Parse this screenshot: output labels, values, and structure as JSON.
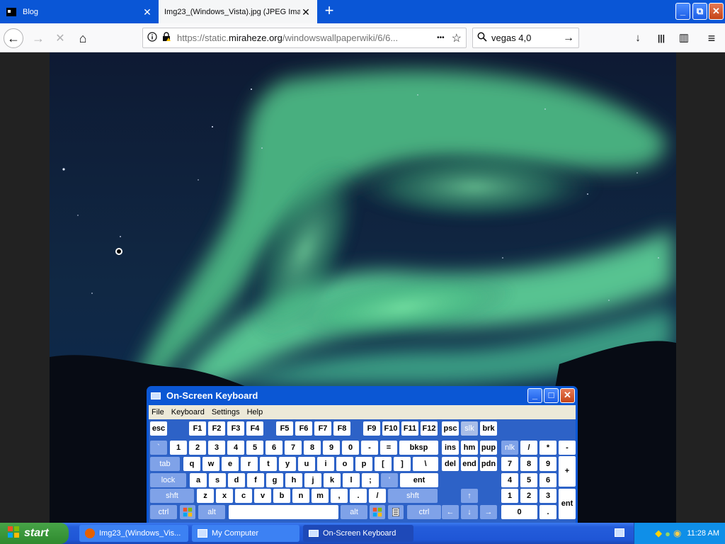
{
  "tabs": [
    {
      "title": "Blog",
      "close": "✕"
    },
    {
      "title": "Img23_(Windows_Vista).jpg (JPEG Ima",
      "close": "✕"
    }
  ],
  "new_tab_label": "+",
  "window_controls": {
    "minimize": "_",
    "restore": "⧉",
    "close": "✕"
  },
  "nav": {
    "back": "←",
    "forward": "→",
    "stop": "✕",
    "home": "⌂",
    "url_prefix": "https://static.",
    "url_host": "miraheze.org",
    "url_path": "/windowswallpaperwiki/6/6...",
    "more": "•••",
    "star": "☆",
    "search_value": "vegas 4,0",
    "search_go": "→",
    "download": "↓",
    "library": "|||",
    "sidebar": "▥",
    "menu": "≡"
  },
  "osk": {
    "title": "On-Screen Keyboard",
    "menu": [
      "File",
      "Keyboard",
      "Settings",
      "Help"
    ],
    "row_fn": [
      "esc",
      "F1",
      "F2",
      "F3",
      "F4",
      "F5",
      "F6",
      "F7",
      "F8",
      "F9",
      "F10",
      "F11",
      "F12",
      "psc",
      "slk",
      "brk"
    ],
    "row1": [
      "`",
      "1",
      "2",
      "3",
      "4",
      "5",
      "6",
      "7",
      "8",
      "9",
      "0",
      "-",
      "=",
      "bksp",
      "ins",
      "hm",
      "pup",
      "nlk",
      "/",
      "*",
      "-"
    ],
    "row2": [
      "tab",
      "q",
      "w",
      "e",
      "r",
      "t",
      "y",
      "u",
      "i",
      "o",
      "p",
      "[",
      "]",
      "\\",
      "del",
      "end",
      "pdn",
      "7",
      "8",
      "9",
      "+"
    ],
    "row3": [
      "lock",
      "a",
      "s",
      "d",
      "f",
      "g",
      "h",
      "j",
      "k",
      "l",
      ";",
      "'",
      "ent",
      "4",
      "5",
      "6"
    ],
    "row4": [
      "shft",
      "z",
      "x",
      "c",
      "v",
      "b",
      "n",
      "m",
      ",",
      ".",
      "/",
      "shft",
      "↑",
      "1",
      "2",
      "3",
      "ent"
    ],
    "row5": [
      "ctrl",
      "alt",
      "alt",
      "ctrl",
      "←",
      "↓",
      "→",
      "0",
      "."
    ],
    "controls": {
      "minimize": "_",
      "maximize": "□",
      "close": "✕"
    }
  },
  "taskbar": {
    "start": "start",
    "items": [
      "Img23_(Windows_Vis...",
      "My Computer",
      "On-Screen Keyboard"
    ],
    "clock": "11:28 AM"
  },
  "colors": {
    "titlebar": "#0a56d6",
    "osk_frame": "#0b57d4",
    "taskbar": "#245ddb",
    "start": "#3c9a3c"
  }
}
